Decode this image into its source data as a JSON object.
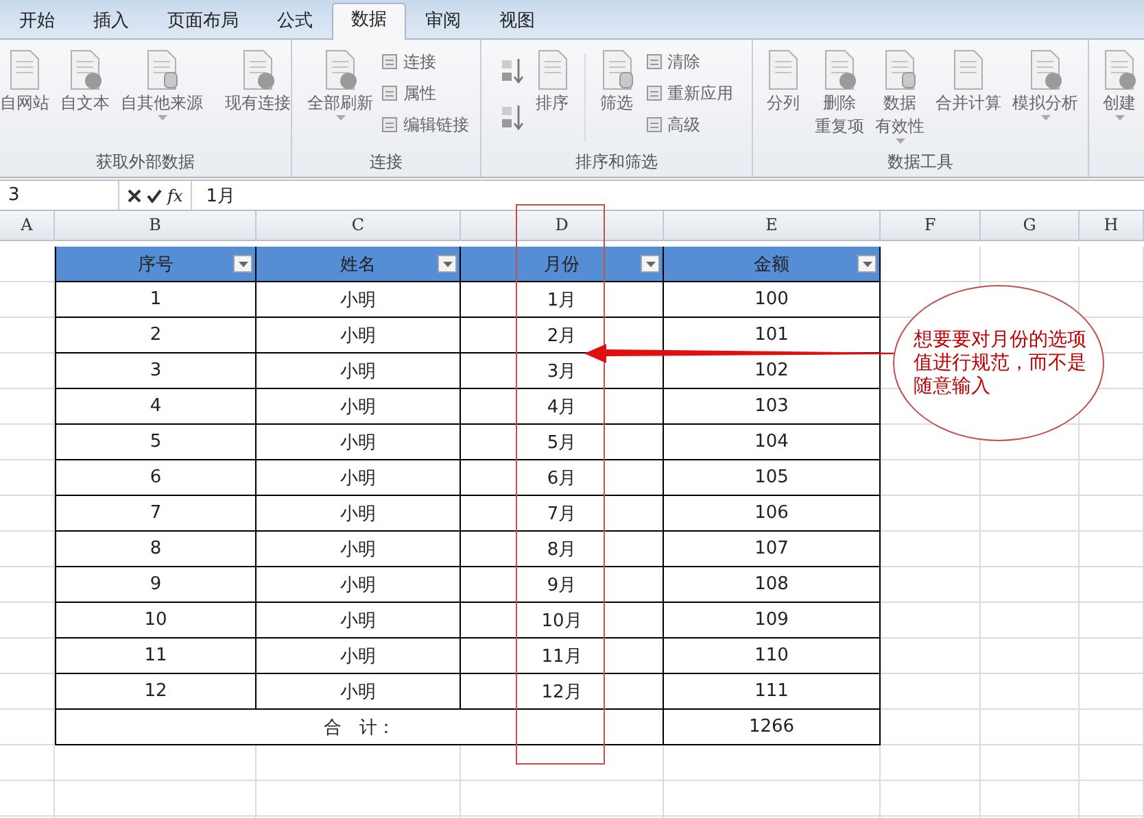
{
  "tabs": [
    {
      "label": "开始",
      "selected": false
    },
    {
      "label": "插入",
      "selected": false
    },
    {
      "label": "页面布局",
      "selected": false
    },
    {
      "label": "公式",
      "selected": false
    },
    {
      "label": "数据",
      "selected": true
    },
    {
      "label": "审阅",
      "selected": false
    },
    {
      "label": "视图",
      "selected": false
    }
  ],
  "ribbon": {
    "groups": [
      {
        "label": "获取外部数据",
        "items": [
          {
            "kind": "large",
            "lines": [
              "自网站"
            ],
            "dropdown": false
          },
          {
            "kind": "large",
            "lines": [
              "自文本"
            ],
            "dropdown": false
          },
          {
            "kind": "large",
            "lines": [
              "自其他来源"
            ],
            "dropdown": true
          },
          {
            "kind": "separator"
          },
          {
            "kind": "large",
            "lines": [
              "现有连接"
            ],
            "dropdown": false
          }
        ]
      },
      {
        "label": "连接",
        "items": [
          {
            "kind": "large",
            "lines": [
              "全部刷新"
            ],
            "dropdown": true
          },
          {
            "kind": "stack",
            "labels": [
              "连接",
              "属性",
              "编辑链接"
            ]
          }
        ]
      },
      {
        "label": "排序和筛选",
        "items": [
          {
            "kind": "sort_icons"
          },
          {
            "kind": "large",
            "lines": [
              "排序"
            ],
            "dropdown": false
          },
          {
            "kind": "separator"
          },
          {
            "kind": "large",
            "lines": [
              "筛选"
            ],
            "dropdown": false
          },
          {
            "kind": "stack",
            "labels": [
              "清除",
              "重新应用",
              "高级"
            ]
          }
        ]
      },
      {
        "label": "数据工具",
        "items": [
          {
            "kind": "large",
            "lines": [
              "分列"
            ],
            "dropdown": false
          },
          {
            "kind": "large",
            "lines": [
              "删除",
              "重复项"
            ],
            "dropdown": false
          },
          {
            "kind": "large",
            "lines": [
              "数据",
              "有效性"
            ],
            "dropdown": true
          },
          {
            "kind": "large",
            "lines": [
              "合并计算"
            ],
            "dropdown": false
          },
          {
            "kind": "large",
            "lines": [
              "模拟分析"
            ],
            "dropdown": true
          }
        ]
      },
      {
        "items": [
          {
            "kind": "large",
            "lines": [
              "创建"
            ],
            "dropdown": true
          }
        ]
      }
    ]
  },
  "formula_bar": {
    "name_box": "3",
    "function_label": "fx",
    "value": "1月"
  },
  "sheet": {
    "columns": [
      "A",
      "B",
      "C",
      "D",
      "E",
      "F",
      "G",
      "H"
    ],
    "table": {
      "headers": [
        "序号",
        "姓名",
        "月份",
        "金额"
      ],
      "rows": [
        [
          "1",
          "小明",
          "1月",
          "100"
        ],
        [
          "2",
          "小明",
          "2月",
          "101"
        ],
        [
          "3",
          "小明",
          "3月",
          "102"
        ],
        [
          "4",
          "小明",
          "4月",
          "103"
        ],
        [
          "5",
          "小明",
          "5月",
          "104"
        ],
        [
          "6",
          "小明",
          "6月",
          "105"
        ],
        [
          "7",
          "小明",
          "7月",
          "106"
        ],
        [
          "8",
          "小明",
          "8月",
          "107"
        ],
        [
          "9",
          "小明",
          "9月",
          "108"
        ],
        [
          "10",
          "小明",
          "10月",
          "109"
        ],
        [
          "11",
          "小明",
          "11月",
          "110"
        ],
        [
          "12",
          "小明",
          "12月",
          "111"
        ]
      ],
      "total_label": "合　计：",
      "total_value": "1266"
    }
  },
  "callout": {
    "text": "想要要对月份的选项值进行规范，而不是随意输入"
  }
}
